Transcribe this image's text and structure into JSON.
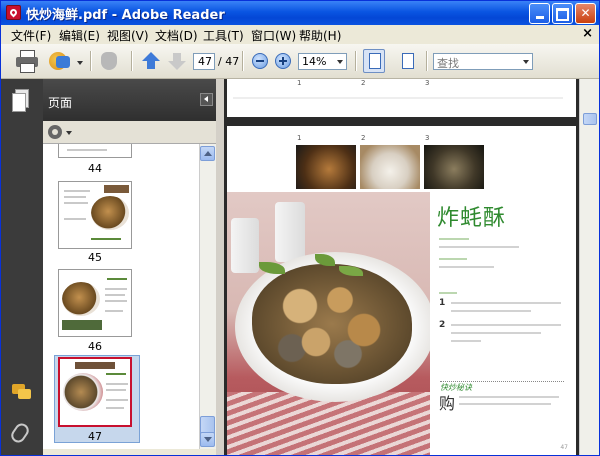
{
  "window": {
    "title": "快炒海鲜.pdf - Adobe Reader"
  },
  "menu": {
    "items": [
      "文件(F)",
      "编辑(E)",
      "视图(V)",
      "文档(D)",
      "工具(T)",
      "窗口(W)",
      "帮助(H)"
    ],
    "close_glyph": "×"
  },
  "toolbar": {
    "current_page": "47",
    "total_pages": "/ 47",
    "zoom": "14%",
    "search_placeholder": "查找"
  },
  "pages_panel": {
    "title": "页面",
    "thumbnails": [
      {
        "page": "44"
      },
      {
        "page": "45"
      },
      {
        "page": "46"
      },
      {
        "page": "47",
        "selected": true
      }
    ]
  },
  "document": {
    "prev_page_ticks": [
      "1",
      "2",
      "3"
    ],
    "page_ticks": [
      "1",
      "2",
      "3"
    ],
    "dish_title": "炸蚝酥",
    "tips_title": "快炒秘诀",
    "tips_big_char": "购",
    "steps": [
      "1",
      "2"
    ]
  },
  "icons": {
    "print": "printer-icon",
    "sign": "sign-icon",
    "hand": "hand-icon",
    "prev_page": "arrow-up-icon",
    "next_page": "arrow-down-icon",
    "zoom_out": "zoom-out-icon",
    "zoom_in": "zoom-in-icon",
    "fit_page": "fit-page-icon",
    "fit_width": "fit-width-icon",
    "pages": "pages-icon",
    "comments": "comments-icon",
    "attachments": "paperclip-icon",
    "options": "gear-icon"
  },
  "colors": {
    "titlebar": "#0a55e2",
    "dish_title": "#2f8a2f",
    "selected_thumb_border": "#c8102e",
    "nav_dark": "#3b3b3b"
  }
}
